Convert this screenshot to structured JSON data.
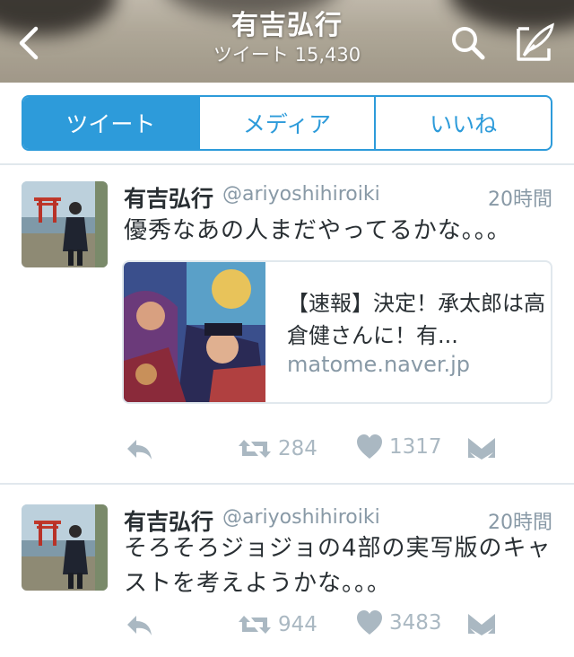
{
  "header": {
    "title": "有吉弘行",
    "subtitle": "ツイート 15,430"
  },
  "tabs": [
    {
      "label": "ツイート",
      "selected": true
    },
    {
      "label": "メディア",
      "selected": false
    },
    {
      "label": "いいね",
      "selected": false
    }
  ],
  "tweets": [
    {
      "name": "有吉弘行",
      "handle": "@ariyoshihiroiki",
      "time": "20時間",
      "text": "優秀なあの人まだやってるかな。。。",
      "card": {
        "title": "【速報】決定！承太郎は高倉健さんに！有...",
        "domain": "matome.naver.jp"
      },
      "retweets": "284",
      "likes": "1317"
    },
    {
      "name": "有吉弘行",
      "handle": "@ariyoshihiroiki",
      "time": "20時間",
      "text": "そろそろジョジョの4部の実写版のキャストを考えようかな。。。",
      "retweets": "944",
      "likes": "3483"
    }
  ],
  "colors": {
    "accent": "#2d9bda",
    "muted": "#aab8c2",
    "secondary_text": "#8899a6"
  }
}
